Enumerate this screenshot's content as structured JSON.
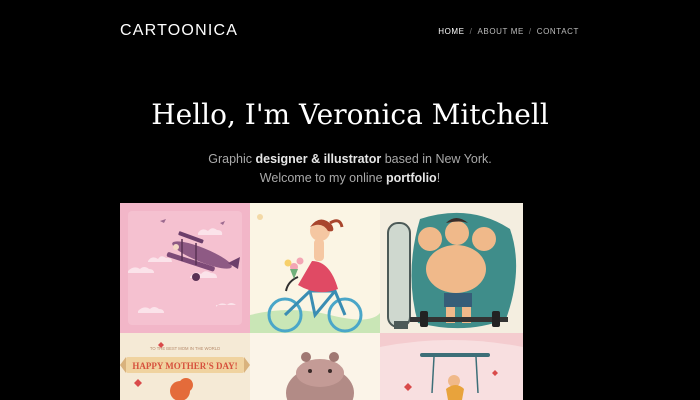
{
  "site": {
    "logo": "CARTOONICA"
  },
  "nav": {
    "items": [
      {
        "label": "HOME"
      },
      {
        "label": "ABOUT ME"
      },
      {
        "label": "CONTACT"
      }
    ],
    "separator": "/"
  },
  "hero": {
    "title": "Hello, I'm Veronica Mitchell",
    "line1": {
      "pre": "Graphic ",
      "bold1": "designer & illustrator",
      "post": " based in New York."
    },
    "line2": {
      "pre": "Welcome to my online ",
      "bold": "portfolio",
      "post": "!"
    }
  },
  "gallery": {
    "tiles": [
      {
        "subject": "biplane illustration"
      },
      {
        "subject": "girl on bicycle illustration"
      },
      {
        "subject": "strongman mirror illustration"
      },
      {
        "subject": "mother's day card",
        "text_top": "TO THE BEST MOM IN THE WORLD",
        "text_banner": "HAPPY MOTHER'S DAY!"
      },
      {
        "subject": "hippo illustration"
      },
      {
        "subject": "swing illustration"
      }
    ]
  },
  "colors": {
    "background": "#000000",
    "text": "#ffffff",
    "muted": "#a9a9a9"
  }
}
